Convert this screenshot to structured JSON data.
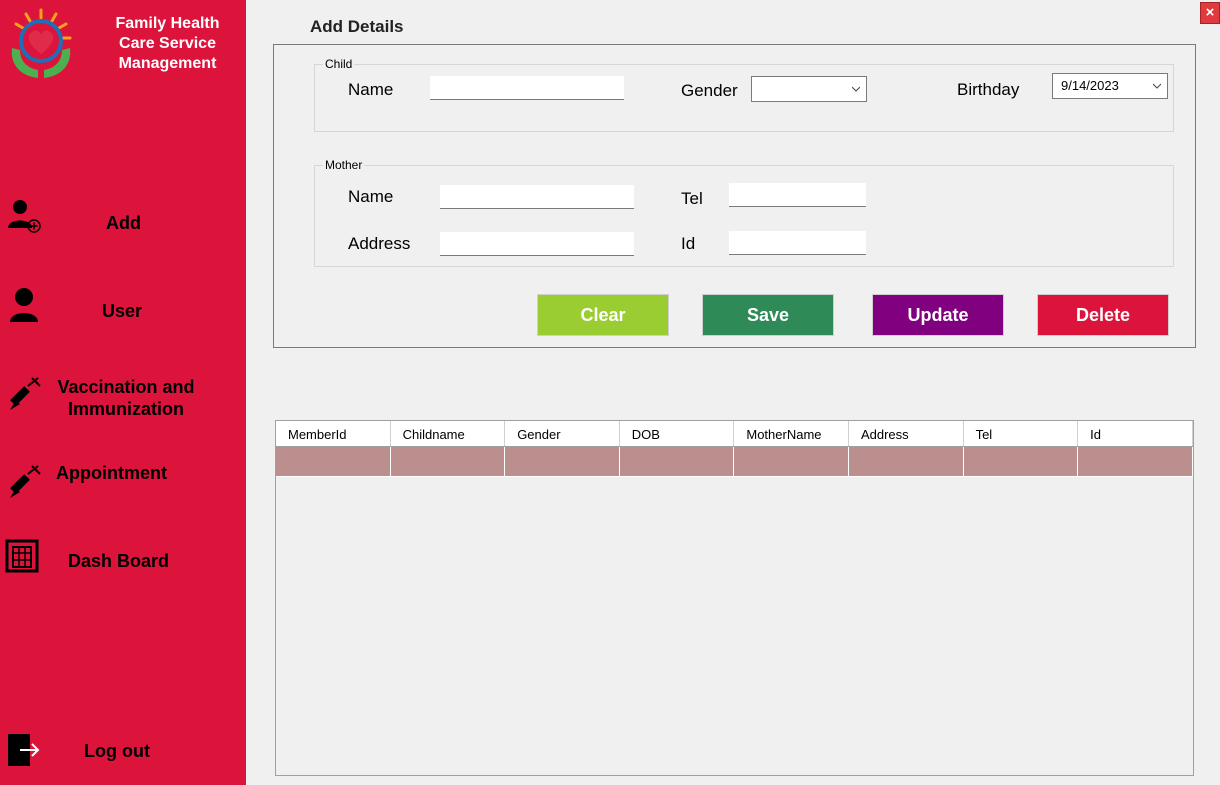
{
  "brand": {
    "line1": "Family Health",
    "line2": "Care Service",
    "line3": "Management"
  },
  "nav": {
    "add": "Add",
    "user": "User",
    "vaccination_line1": "Vaccination and",
    "vaccination_line2": "Immunization",
    "appointment": "Appointment",
    "dashboard": "Dash Board",
    "logout": "Log out"
  },
  "page_title": "Add Details",
  "close_label": "×",
  "child": {
    "legend": "Child",
    "name_label": "Name",
    "name_value": "",
    "gender_label": "Gender",
    "gender_value": "",
    "birthday_label": "Birthday",
    "birthday_value": "9/14/2023"
  },
  "mother": {
    "legend": "Mother",
    "name_label": "Name",
    "name_value": "",
    "tel_label": "Tel",
    "tel_value": "",
    "address_label": "Address",
    "address_value": "",
    "id_label": "Id",
    "id_value": ""
  },
  "buttons": {
    "clear": "Clear",
    "save": "Save",
    "update": "Update",
    "delete": "Delete"
  },
  "colors": {
    "sidebar": "#dc143c",
    "clear": "#9acd32",
    "save": "#2e8b57",
    "update": "#800080",
    "delete": "#dc143c",
    "grid_row": "#bc8f8f"
  },
  "table": {
    "columns": [
      "MemberId",
      "Childname",
      "Gender",
      "DOB",
      "MotherName",
      "Address",
      "Tel",
      "Id"
    ],
    "rows": [
      [
        "",
        "",
        "",
        "",
        "",
        "",
        "",
        ""
      ]
    ]
  }
}
